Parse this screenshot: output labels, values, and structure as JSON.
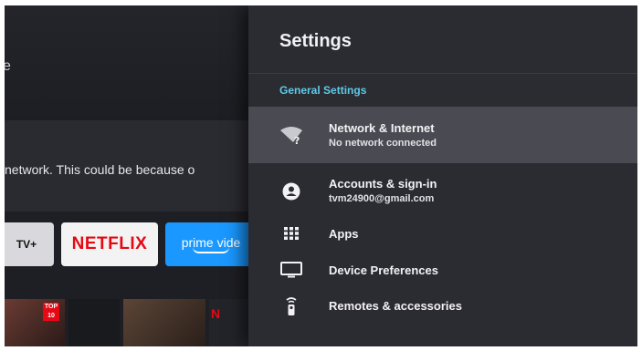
{
  "background": {
    "top_letter": "e",
    "banner_text": "network. This could be because o",
    "apps": [
      {
        "name": "TV+"
      },
      {
        "name": "NETFLIX"
      },
      {
        "name": "prime vide"
      }
    ],
    "thumb_badge": "TOP 10",
    "thumb_logo": "N"
  },
  "settings": {
    "title": "Settings",
    "section": "General Settings",
    "items": [
      {
        "label": "Network & Internet",
        "sublabel": "No network connected",
        "icon": "wifi-question-icon",
        "selected": true
      },
      {
        "label": "Accounts & sign-in",
        "sublabel": "tvm24900@gmail.com",
        "icon": "account-icon"
      },
      {
        "label": "Apps",
        "icon": "apps-grid-icon"
      },
      {
        "label": "Device Preferences",
        "icon": "tv-icon"
      },
      {
        "label": "Remotes & accessories",
        "icon": "remote-icon"
      }
    ]
  },
  "colors": {
    "panel_bg": "#2b2b32",
    "selected_bg": "#4a4a52",
    "section_accent": "#5ecbe6",
    "netflix_red": "#e50914",
    "prime_blue": "#1a98ff"
  }
}
